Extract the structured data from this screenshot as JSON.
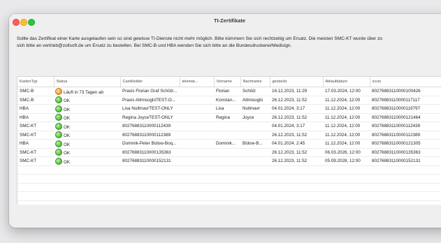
{
  "window": {
    "title": "TI-Zertifikate"
  },
  "info": {
    "line1": "Sollte das Zertifikat einer Karte ausgelaufen sein so sind gewisse TI-Dienste nicht mehr möglich. Bitte kümmern Sie sich rechtzeitig um Ersatz. Die meisten SMC-KT wurde über zo",
    "line2": "sich bitte an  vertrieb@zollsoft.de  um Ersatz zu bestellen. Bei SMC-B und HBA wenden Sie sich bitte an die Bundesdruckerei/Medisign."
  },
  "table": {
    "headers": [
      "KartenTyp",
      "Status",
      "CardHolder",
      "telemat...",
      "Vorname",
      "Nachname",
      "gesteckt",
      "Ablaufdatum",
      "iccsn"
    ],
    "rows": [
      {
        "typ": "SMC-B",
        "status": "Läuft in 73 Tagen ab",
        "status_color": "orange",
        "holder": "Praxis Florian Graf Schölz...",
        "telematik": "",
        "vorname": "Florian",
        "nachname": "Schölz",
        "gesteckt": "16.12.2023, 11:29",
        "ablauf": "17.03.2024, 12:00",
        "iccsn": "80276883110000100426"
      },
      {
        "typ": "SMC-B",
        "status": "OK",
        "status_color": "green",
        "holder": "Praxis AltmisoglüTEST-O...",
        "telematik": "",
        "vorname": "Konstan...",
        "nachname": "Altmisoglü",
        "gesteckt": "26.12.2023, 11:52",
        "ablauf": "11.12.2024, 12:00",
        "iccsn": "80276883110000117117"
      },
      {
        "typ": "HBA",
        "status": "OK",
        "status_color": "green",
        "holder": "Lisa NullmavrTEST-ONLY",
        "telematik": "",
        "vorname": "Lisa",
        "nachname": "Nullmavr",
        "gesteckt": "04.01.2024, 3:17",
        "ablauf": "11.12.2024, 12:00",
        "iccsn": "80276883110000119797"
      },
      {
        "typ": "HBA",
        "status": "OK",
        "status_color": "green",
        "holder": "Regina JoyceTEST-ONLY",
        "telematik": "",
        "vorname": "Regina",
        "nachname": "Joyce",
        "gesteckt": "26.12.2023, 11:52",
        "ablauf": "11.12.2024, 12:00",
        "iccsn": "80276883110000121464"
      },
      {
        "typ": "SMC-KT",
        "status": "OK",
        "status_color": "green",
        "holder": "80276883110000112439",
        "telematik": "",
        "vorname": "",
        "nachname": "",
        "gesteckt": "04.01.2024, 3:17",
        "ablauf": "11.12.2024, 12:00",
        "iccsn": "80276883110000112439"
      },
      {
        "typ": "SMC-KT",
        "status": "OK",
        "status_color": "green",
        "holder": "80276883110000112389",
        "telematik": "",
        "vorname": "",
        "nachname": "",
        "gesteckt": "26.12.2023, 11:52",
        "ablauf": "11.12.2024, 12:00",
        "iccsn": "80276883110000112389"
      },
      {
        "typ": "HBA",
        "status": "OK",
        "status_color": "green",
        "holder": "Dominik-Peter Bülow-Boq...",
        "telematik": "",
        "vorname": "Dominik...",
        "nachname": "Bülow-B...",
        "gesteckt": "04.01.2024, 2:45",
        "ablauf": "11.12.2024, 12:00",
        "iccsn": "80276883110000121305"
      },
      {
        "typ": "SMC-KT",
        "status": "OK",
        "status_color": "green",
        "holder": "80276883110000135363",
        "telematik": "",
        "vorname": "",
        "nachname": "",
        "gesteckt": "26.12.2023, 11:52",
        "ablauf": "06.03.2026, 12:00",
        "iccsn": "80276883110000135363"
      },
      {
        "typ": "SMC-KT",
        "status": "OK",
        "status_color": "green",
        "holder": "80276883110000152131",
        "telematik": "",
        "vorname": "",
        "nachname": "",
        "gesteckt": "26.12.2023, 11:52",
        "ablauf": "05.09.2028, 12:00",
        "iccsn": "80276883110000152131"
      }
    ]
  }
}
